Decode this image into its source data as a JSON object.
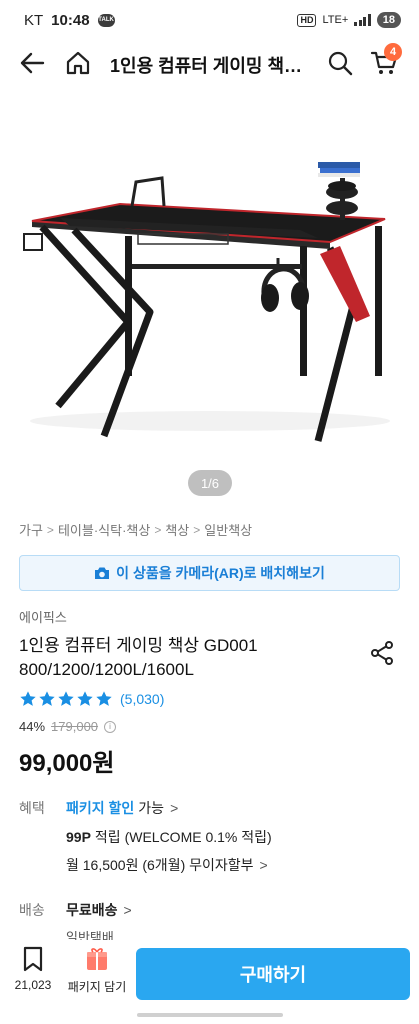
{
  "status_bar": {
    "carrier": "KT",
    "time": "10:48",
    "talk_icon": "TALK",
    "network": "LTE+",
    "battery": "18"
  },
  "header": {
    "title": "1인용 컴퓨터 게이밍 책…",
    "cart_count": "4"
  },
  "gallery": {
    "counter": "1/6"
  },
  "breadcrumb": {
    "items": [
      "가구",
      "테이블·식탁·책상",
      "책상",
      "일반책상"
    ]
  },
  "ar_button": {
    "label": "이 상품을 카메라(AR)로 배치해보기"
  },
  "product": {
    "brand": "에이픽스",
    "title_line1": "1인용 컴퓨터 게이밍 책상 GD001",
    "title_line2": "800/1200/1200L/1600L",
    "rating_stars": 5,
    "review_count": "(5,030)",
    "discount_rate": "44%",
    "original_price": "179,000",
    "sale_price": "99,000원"
  },
  "benefits": {
    "label": "혜택",
    "package_discount": "패키지 할인",
    "package_available": "가능",
    "points": "99P",
    "points_text": "적립 (WELCOME 0.1% 적립)",
    "installment": "월 16,500원 (6개월) 무이자할부"
  },
  "shipping": {
    "label": "배송",
    "free_shipping": "무료배송",
    "method": "일반택배"
  },
  "bottom_bar": {
    "bookmark_count": "21,023",
    "package_label": "패키지 담기",
    "buy_label": "구매하기"
  },
  "colors": {
    "accent": "#2aa7f0",
    "link": "#1a8fe3",
    "cart_badge": "#ff6b3d",
    "desk_red": "#c0262c"
  }
}
